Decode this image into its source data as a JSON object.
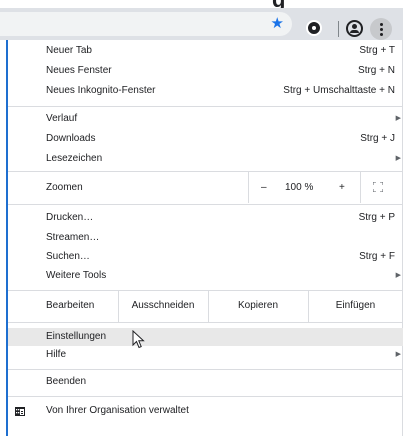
{
  "toolbar": {
    "star_icon": "bookmark-star-icon",
    "extension_icon": "extension-icon",
    "profile_icon": "profile-icon",
    "menu_icon": "three-dots-menu-icon",
    "accent": "#1a73e8"
  },
  "menu": {
    "new_tab": {
      "label": "Neuer Tab",
      "shortcut": "Strg + T"
    },
    "new_window": {
      "label": "Neues Fenster",
      "shortcut": "Strg + N"
    },
    "incognito": {
      "label": "Neues Inkognito-Fenster",
      "shortcut": "Strg + Umschalttaste + N"
    },
    "history": {
      "label": "Verlauf"
    },
    "downloads": {
      "label": "Downloads",
      "shortcut": "Strg + J"
    },
    "bookmarks": {
      "label": "Lesezeichen"
    },
    "zoom": {
      "label": "Zoomen",
      "minus": "–",
      "value": "100 %",
      "plus": "+"
    },
    "print": {
      "label": "Drucken…",
      "shortcut": "Strg + P"
    },
    "cast": {
      "label": "Streamen…"
    },
    "find": {
      "label": "Suchen…",
      "shortcut": "Strg + F"
    },
    "more_tools": {
      "label": "Weitere Tools"
    },
    "edit": {
      "label": "Bearbeiten",
      "cut": "Ausschneiden",
      "copy": "Kopieren",
      "paste": "Einfügen"
    },
    "settings": {
      "label": "Einstellungen"
    },
    "help": {
      "label": "Hilfe"
    },
    "exit": {
      "label": "Beenden"
    },
    "managed": {
      "label": "Von Ihrer Organisation verwaltet"
    }
  }
}
